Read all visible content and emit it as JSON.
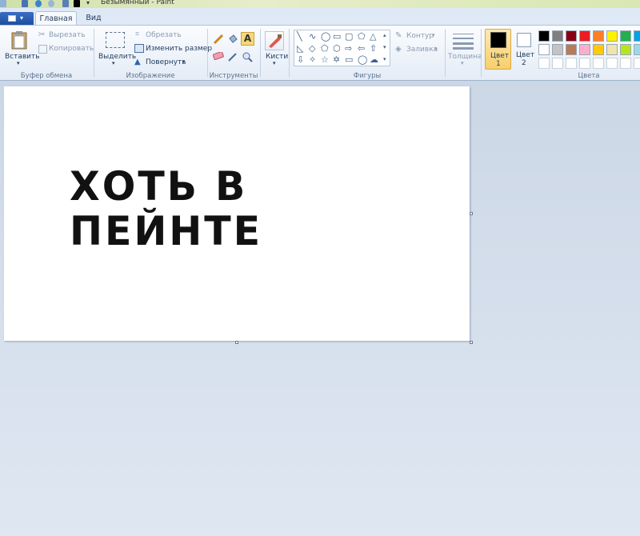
{
  "window": {
    "title": "Безымянный - Paint"
  },
  "tabs": [
    {
      "label": "Главная"
    },
    {
      "label": "Вид"
    }
  ],
  "clipboard": {
    "paste": "Вставить",
    "cut": "Вырезать",
    "copy": "Копировать",
    "group": "Буфер обмена"
  },
  "image": {
    "select": "Выделить",
    "crop": "Обрезать",
    "resize": "Изменить размер",
    "rotate": "Повернуть",
    "group": "Изображение"
  },
  "tools": {
    "group": "Инструменты"
  },
  "brushes": {
    "label": "Кисти"
  },
  "shapes": {
    "group": "Фигуры",
    "outline": "Контур",
    "fill": "Заливка"
  },
  "size": {
    "label": "Толщина"
  },
  "color1": {
    "label": "Цвет",
    "num": "1",
    "value": "#000000"
  },
  "color2": {
    "label": "Цвет",
    "num": "2",
    "value": "#ffffff"
  },
  "colors": {
    "group": "Цвета",
    "row1": [
      "#000000",
      "#7f7f7f",
      "#880015",
      "#ed1c24",
      "#ff7f27",
      "#fff200",
      "#22b14c",
      "#00a2e8"
    ],
    "row2": [
      "#ffffff",
      "#c3c3c3",
      "#b97a57",
      "#ffaec9",
      "#ffc90e",
      "#efe4b0",
      "#b5e61d",
      "#99d9ea"
    ]
  },
  "canvas": {
    "line1": "ХОТЬ В",
    "line2": "ПЕЙНТЕ"
  }
}
